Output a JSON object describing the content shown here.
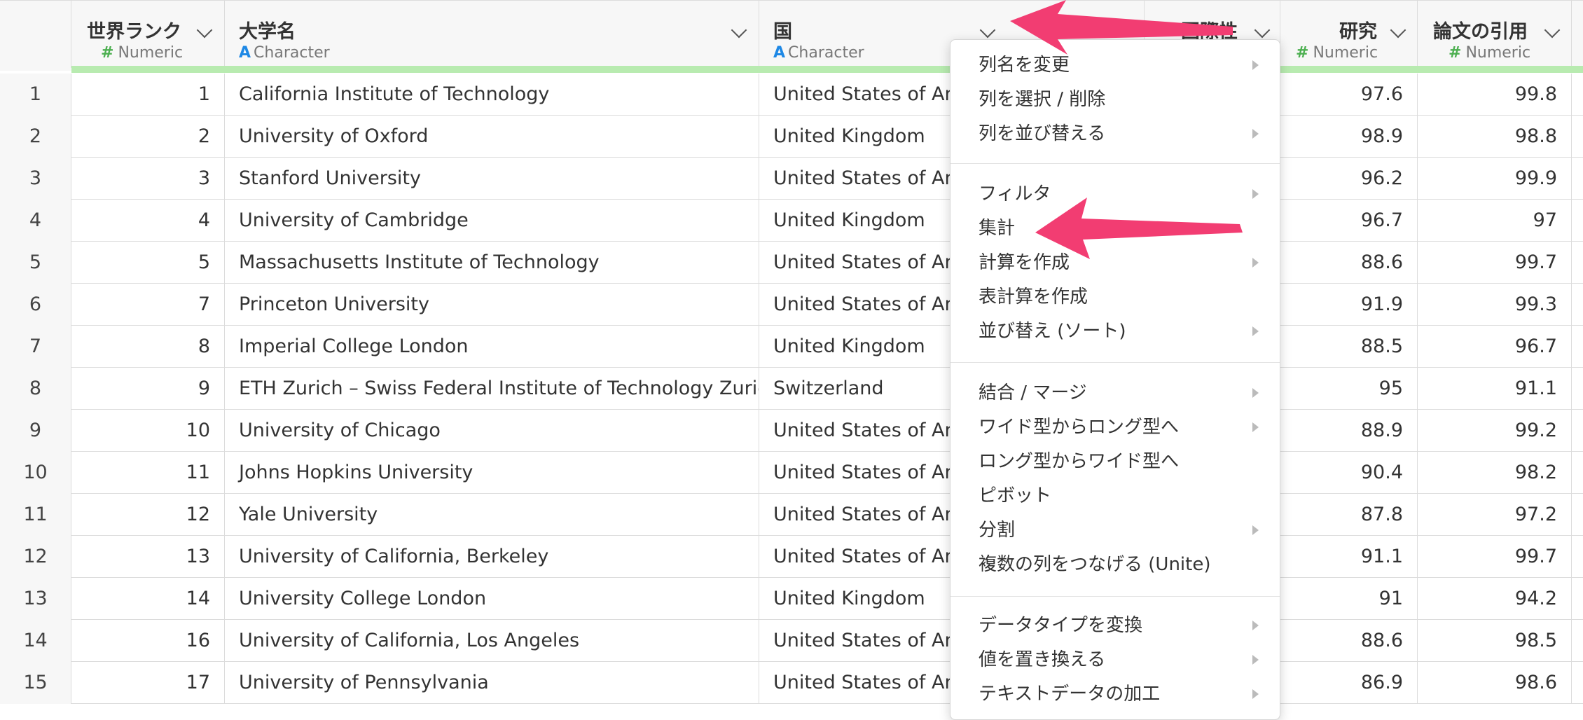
{
  "columns": [
    {
      "title": "世界ランク",
      "type": "Numeric"
    },
    {
      "title": "大学名",
      "type": "Character"
    },
    {
      "title": "国",
      "type": "Character"
    },
    {
      "title": "国際性",
      "type": ""
    },
    {
      "title": "研究",
      "type": "Numeric"
    },
    {
      "title": "論文の引用",
      "type": "Numeric"
    }
  ],
  "rows": [
    {
      "n": "1",
      "rank": "1",
      "name": "California Institute of Technology",
      "country": "United States of Am",
      "research": "97.6",
      "citations": "99.8"
    },
    {
      "n": "2",
      "rank": "2",
      "name": "University of Oxford",
      "country": "United Kingdom",
      "research": "98.9",
      "citations": "98.8"
    },
    {
      "n": "3",
      "rank": "3",
      "name": "Stanford University",
      "country": "United States of Am",
      "research": "96.2",
      "citations": "99.9"
    },
    {
      "n": "4",
      "rank": "4",
      "name": "University of Cambridge",
      "country": "United Kingdom",
      "research": "96.7",
      "citations": "97"
    },
    {
      "n": "5",
      "rank": "5",
      "name": "Massachusetts Institute of Technology",
      "country": "United States of Am",
      "research": "88.6",
      "citations": "99.7"
    },
    {
      "n": "6",
      "rank": "7",
      "name": "Princeton University",
      "country": "United States of Am",
      "research": "91.9",
      "citations": "99.3"
    },
    {
      "n": "7",
      "rank": "8",
      "name": "Imperial College London",
      "country": "United Kingdom",
      "research": "88.5",
      "citations": "96.7"
    },
    {
      "n": "8",
      "rank": "9",
      "name": "ETH Zurich – Swiss Federal Institute of Technology Zurich",
      "country": "Switzerland",
      "research": "95",
      "citations": "91.1"
    },
    {
      "n": "9",
      "rank": "10",
      "name": "University of Chicago",
      "country": "United States of Am",
      "research": "88.9",
      "citations": "99.2"
    },
    {
      "n": "10",
      "rank": "11",
      "name": "Johns Hopkins University",
      "country": "United States of Am",
      "research": "90.4",
      "citations": "98.2"
    },
    {
      "n": "11",
      "rank": "12",
      "name": "Yale University",
      "country": "United States of Am",
      "research": "87.8",
      "citations": "97.2"
    },
    {
      "n": "12",
      "rank": "13",
      "name": "University of California, Berkeley",
      "country": "United States of Am",
      "research": "91.1",
      "citations": "99.7"
    },
    {
      "n": "13",
      "rank": "14",
      "name": "University College London",
      "country": "United Kingdom",
      "research": "91",
      "citations": "94.2"
    },
    {
      "n": "14",
      "rank": "16",
      "name": "University of California, Los Angeles",
      "country": "United States of Am",
      "research": "88.6",
      "citations": "98.5"
    },
    {
      "n": "15",
      "rank": "17",
      "name": "University of Pennsylvania",
      "country": "United States of Am",
      "research": "86.9",
      "citations": "98.6"
    }
  ],
  "menu": [
    {
      "label": "列名を変更",
      "submenu": true
    },
    {
      "label": "列を選択 / 削除",
      "submenu": false
    },
    {
      "label": "列を並び替える",
      "submenu": true
    },
    {
      "label": "フィルタ",
      "submenu": true
    },
    {
      "label": "集計",
      "submenu": false
    },
    {
      "label": "計算を作成",
      "submenu": true
    },
    {
      "label": "表計算を作成",
      "submenu": false
    },
    {
      "label": "並び替え (ソート)",
      "submenu": true
    },
    {
      "label": "結合 / マージ",
      "submenu": true
    },
    {
      "label": "ワイド型からロング型へ",
      "submenu": true
    },
    {
      "label": "ロング型からワイド型へ",
      "submenu": false
    },
    {
      "label": "ピボット",
      "submenu": false
    },
    {
      "label": "分割",
      "submenu": true
    },
    {
      "label": "複数の列をつなげる (Unite)",
      "submenu": false
    },
    {
      "label": "データタイプを変換",
      "submenu": true
    },
    {
      "label": "値を置き換える",
      "submenu": true
    },
    {
      "label": "テキストデータの加工",
      "submenu": true
    }
  ],
  "colors": {
    "annotation_arrow": "#f23d72",
    "header_accent_bar": "#b8ebb0",
    "numeric_type": "#4caf50",
    "character_type": "#1e88e5"
  }
}
